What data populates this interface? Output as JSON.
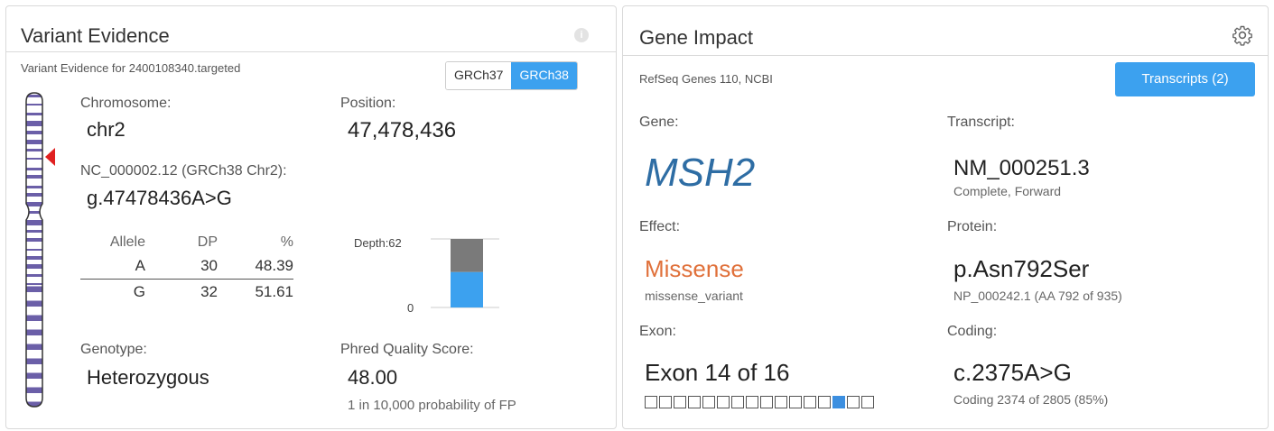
{
  "variant_evidence": {
    "title": "Variant Evidence",
    "info_icon": "i",
    "subtitle": "Variant Evidence for 2400108340.targeted",
    "build_toggle": {
      "options": [
        "GRCh37",
        "GRCh38"
      ],
      "selected": "GRCh38"
    },
    "chromosome_label": "Chromosome:",
    "chromosome_value": "chr2",
    "position_label": "Position:",
    "position_value": "47,478,436",
    "hgvs_label": "NC_000002.12 (GRCh38 Chr2):",
    "hgvs_value": "g.47478436A>G",
    "allele_table": {
      "headers": [
        "Allele",
        "DP",
        "%"
      ],
      "rows": [
        {
          "allele": "A",
          "dp": "30",
          "pct": "48.39"
        },
        {
          "allele": "G",
          "dp": "32",
          "pct": "51.61"
        }
      ]
    },
    "depth": {
      "label": "Depth:62",
      "zero_label": "0",
      "total": 62,
      "alt_fraction": 0.5161
    },
    "genotype_label": "Genotype:",
    "genotype_value": "Heterozygous",
    "phred_label": "Phred Quality Score:",
    "phred_value": "48.00",
    "phred_note": "1 in 10,000 probability of FP",
    "colors": {
      "accent": "#3ca1ef",
      "ref_bar": "#7a7a7a",
      "marker": "#e02020",
      "ideogram_band": "#6b5fa8"
    }
  },
  "gene_impact": {
    "title": "Gene Impact",
    "gear_icon": "gear-icon",
    "source": "RefSeq Genes 110, NCBI",
    "transcripts_button": "Transcripts (2)",
    "gene_label": "Gene:",
    "gene_value": "MSH2",
    "transcript_label": "Transcript:",
    "transcript_value": "NM_000251.3",
    "transcript_note": "Complete, Forward",
    "effect_label": "Effect:",
    "effect_value": "Missense",
    "effect_note": "missense_variant",
    "protein_label": "Protein:",
    "protein_value": "p.Asn792Ser",
    "protein_note": "NP_000242.1 (AA 792 of 935)",
    "exon_label": "Exon:",
    "exon_value": "Exon 14 of 16",
    "exon_current": 14,
    "exon_total": 16,
    "coding_label": "Coding:",
    "coding_value": "c.2375A>G",
    "coding_note": "Coding 2374 of 2805 (85%)",
    "colors": {
      "gene": "#2e6da4",
      "effect": "#e0703a",
      "exon_active": "#3c8fe0"
    }
  }
}
